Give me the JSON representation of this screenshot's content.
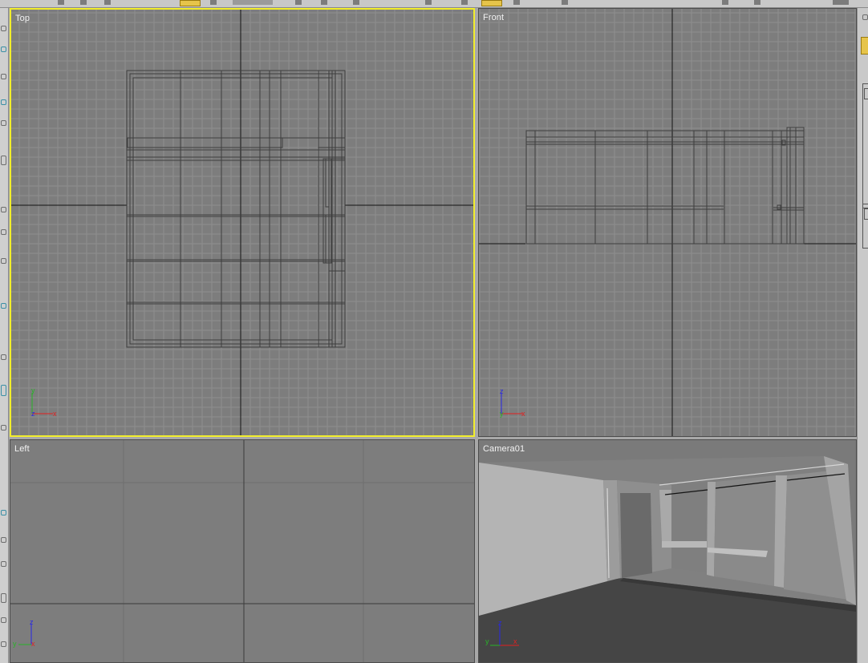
{
  "app": {
    "name": "3D modelling application (viewport layout)",
    "colors": {
      "viewport_bg": "#7d7d7d",
      "grid_minor": "#8e8e8e",
      "grid_major": "#6e6e6e",
      "world_axis": "#141414",
      "wireframe": "#3e3e3e",
      "active_border": "#f2ee2c",
      "label_text": "#f2f2f2",
      "axis_x": "#e32020",
      "axis_y": "#28b428",
      "axis_z": "#2828e6"
    }
  },
  "toolbar": {
    "icons": [
      "undo-icon",
      "redo-icon",
      "select-icon",
      "move-icon",
      "rotate-icon",
      "scale-icon",
      "snap-icon",
      "render-icon"
    ]
  },
  "command_panel": {
    "icons": [
      "create-tab-icon",
      "modify-tab-icon"
    ]
  },
  "viewports": [
    {
      "id": "top",
      "label": "Top",
      "active": true,
      "axes": [
        "y",
        "x"
      ]
    },
    {
      "id": "front",
      "label": "Front",
      "active": false,
      "axes": [
        "z",
        "x"
      ]
    },
    {
      "id": "left",
      "label": "Left",
      "active": false,
      "axes": [
        "z",
        "y"
      ]
    },
    {
      "id": "camera",
      "label": "Camera01",
      "active": false,
      "axes": [
        "z",
        "y",
        "x"
      ]
    }
  ],
  "gizmo_labels": {
    "x": "x",
    "y": "y",
    "z": "z"
  }
}
